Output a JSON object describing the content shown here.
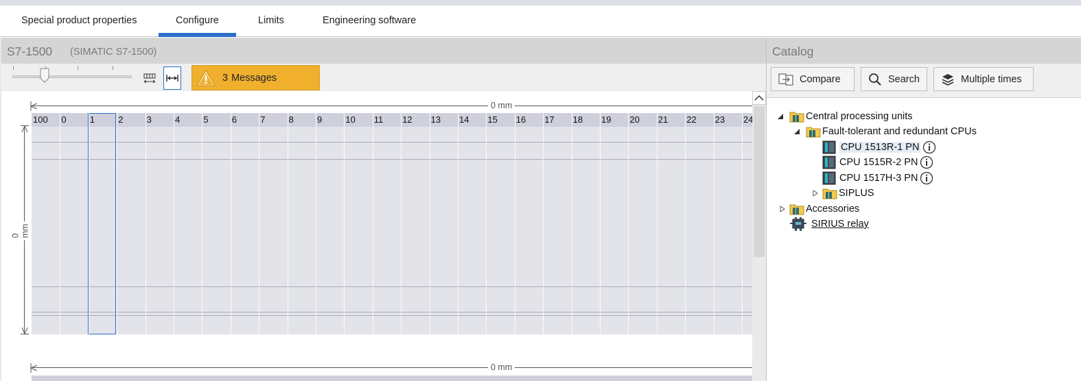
{
  "tabs": [
    {
      "label": "Special product properties",
      "active": false
    },
    {
      "label": "Configure",
      "active": true
    },
    {
      "label": "Limits",
      "active": false
    },
    {
      "label": "Engineering software",
      "active": false
    }
  ],
  "device": {
    "title": "S7-1500",
    "subtitle": "(SIMATIC S7-1500)"
  },
  "toolbar": {
    "messages_count": "3",
    "messages_label": "Messages"
  },
  "canvas": {
    "width_dimension": "0 mm",
    "height_dimension": "0 mm",
    "bottom_dimension": "0 mm",
    "slot_numbers": [
      "100",
      "0",
      "1",
      "2",
      "3",
      "4",
      "5",
      "6",
      "7",
      "8",
      "9",
      "10",
      "11",
      "12",
      "13",
      "14",
      "15",
      "16",
      "17",
      "18",
      "19",
      "20",
      "21",
      "22",
      "23",
      "24"
    ],
    "selected_slot": "1"
  },
  "catalog": {
    "title": "Catalog",
    "buttons": {
      "compare": "Compare",
      "search": "Search",
      "multiple": "Multiple times"
    },
    "tree": {
      "central_processing_units": "Central processing units",
      "fault_tolerant": "Fault-tolerant and redundant CPUs",
      "cpu_1513r": "CPU 1513R-1 PN",
      "cpu_1515r": "CPU 1515R-2 PN",
      "cpu_1517h": "CPU 1517H-3 PN",
      "siplus": "SIPLUS",
      "accessories": "Accessories",
      "sirius_relay": "SIRIUS relay"
    }
  },
  "colors": {
    "accent": "#2a6fc9",
    "warning": "#f0b02e"
  }
}
